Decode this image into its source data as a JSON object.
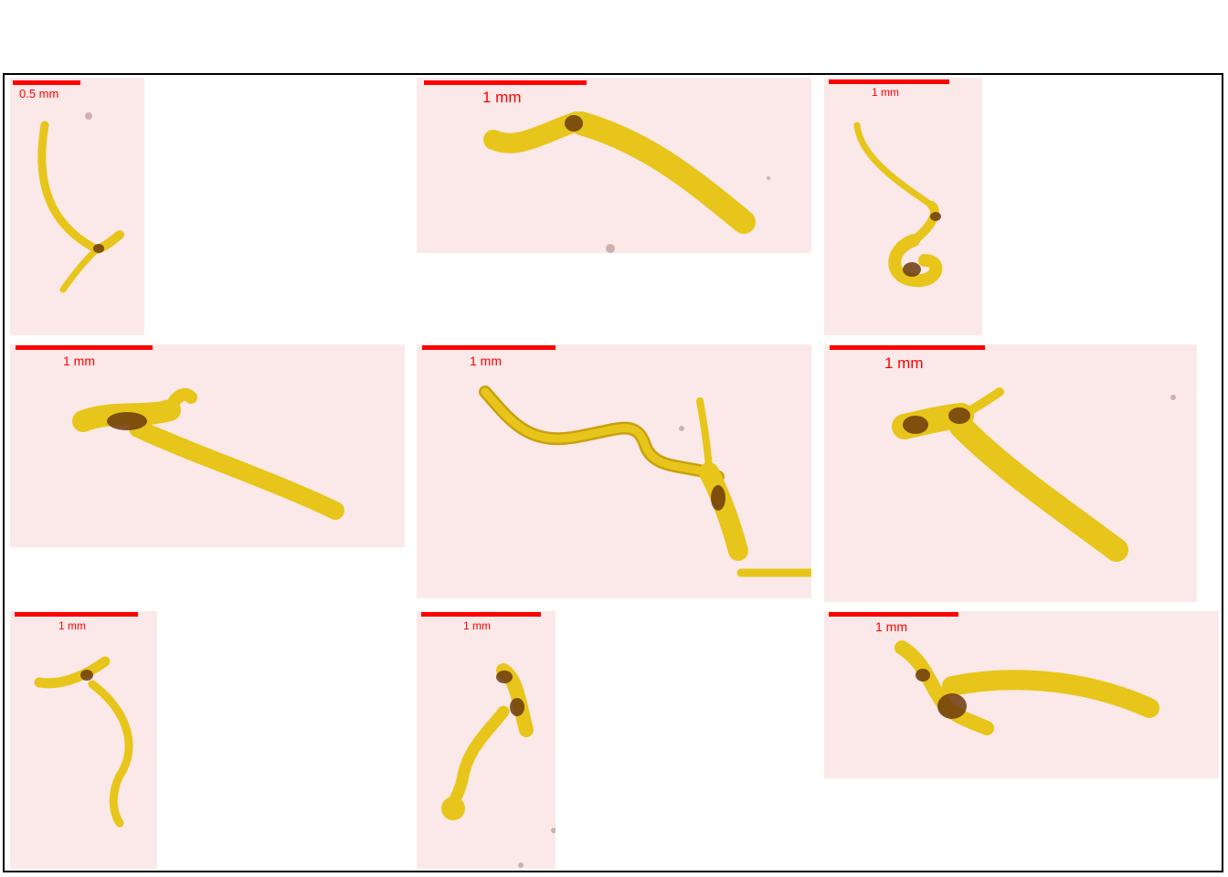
{
  "colors": {
    "scale_bar": "#ff0000",
    "panel_background": "#fbe9e9",
    "specimen": "#e7c51a",
    "specimen_dark": "#6b3a0c"
  },
  "panels": [
    {
      "scale_label": "0.5 mm"
    },
    {
      "scale_label": "1 mm"
    },
    {
      "scale_label": "1 mm"
    },
    {
      "scale_label": "1 mm"
    },
    {
      "scale_label": "1 mm"
    },
    {
      "scale_label": "1 mm"
    },
    {
      "scale_label": "1 mm"
    },
    {
      "scale_label": "1 mm"
    },
    {
      "scale_label": "1 mm"
    }
  ]
}
